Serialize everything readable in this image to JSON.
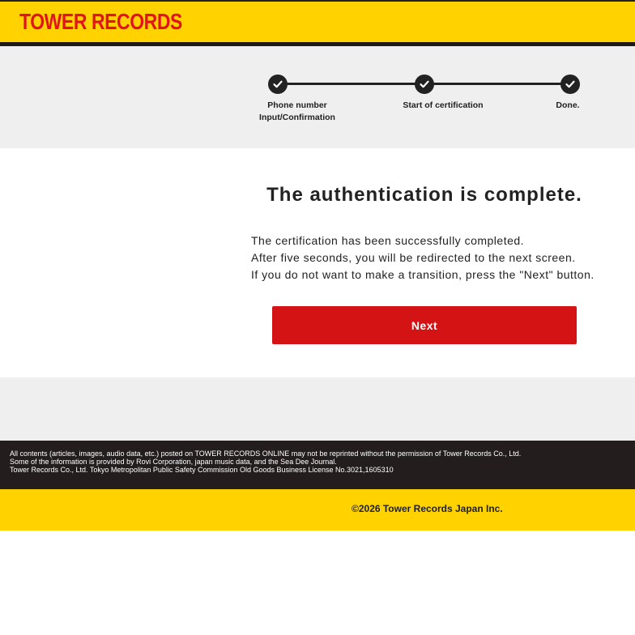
{
  "header": {
    "logo_text": "TOWER RECORDS",
    "brand_color": "#ffd200",
    "logo_color": "#e2141b"
  },
  "steps": {
    "items": [
      {
        "label_line1": "Phone number",
        "label_line2": "Input/Confirmation",
        "status": "done"
      },
      {
        "label_line1": "Start of certification",
        "label_line2": "",
        "status": "done"
      },
      {
        "label_line1": "Done.",
        "label_line2": "",
        "status": "done"
      }
    ],
    "icon": "check-icon"
  },
  "main": {
    "title": "The authentication is complete.",
    "lines": [
      "The certification has been successfully completed.",
      "After five seconds, you will be redirected to the next screen.",
      "If you do not want to make a transition, press the \"Next\" button."
    ],
    "next_label": "Next",
    "button_color": "#d41414"
  },
  "footer": {
    "notice_lines": [
      "All contents (articles, images, audio data, etc.) posted on TOWER RECORDS ONLINE may not be reprinted without the permission of Tower Records Co., Ltd.",
      "Some of the information is provided by Rovi Corporation, japan music data, and the Sea Dee Journal.",
      "Tower Records Co., Ltd. Tokyo Metropolitan Public Safety Commission Old Goods Business License No.3021,1605310"
    ],
    "copyright": "©2026 Tower Records Japan Inc."
  }
}
